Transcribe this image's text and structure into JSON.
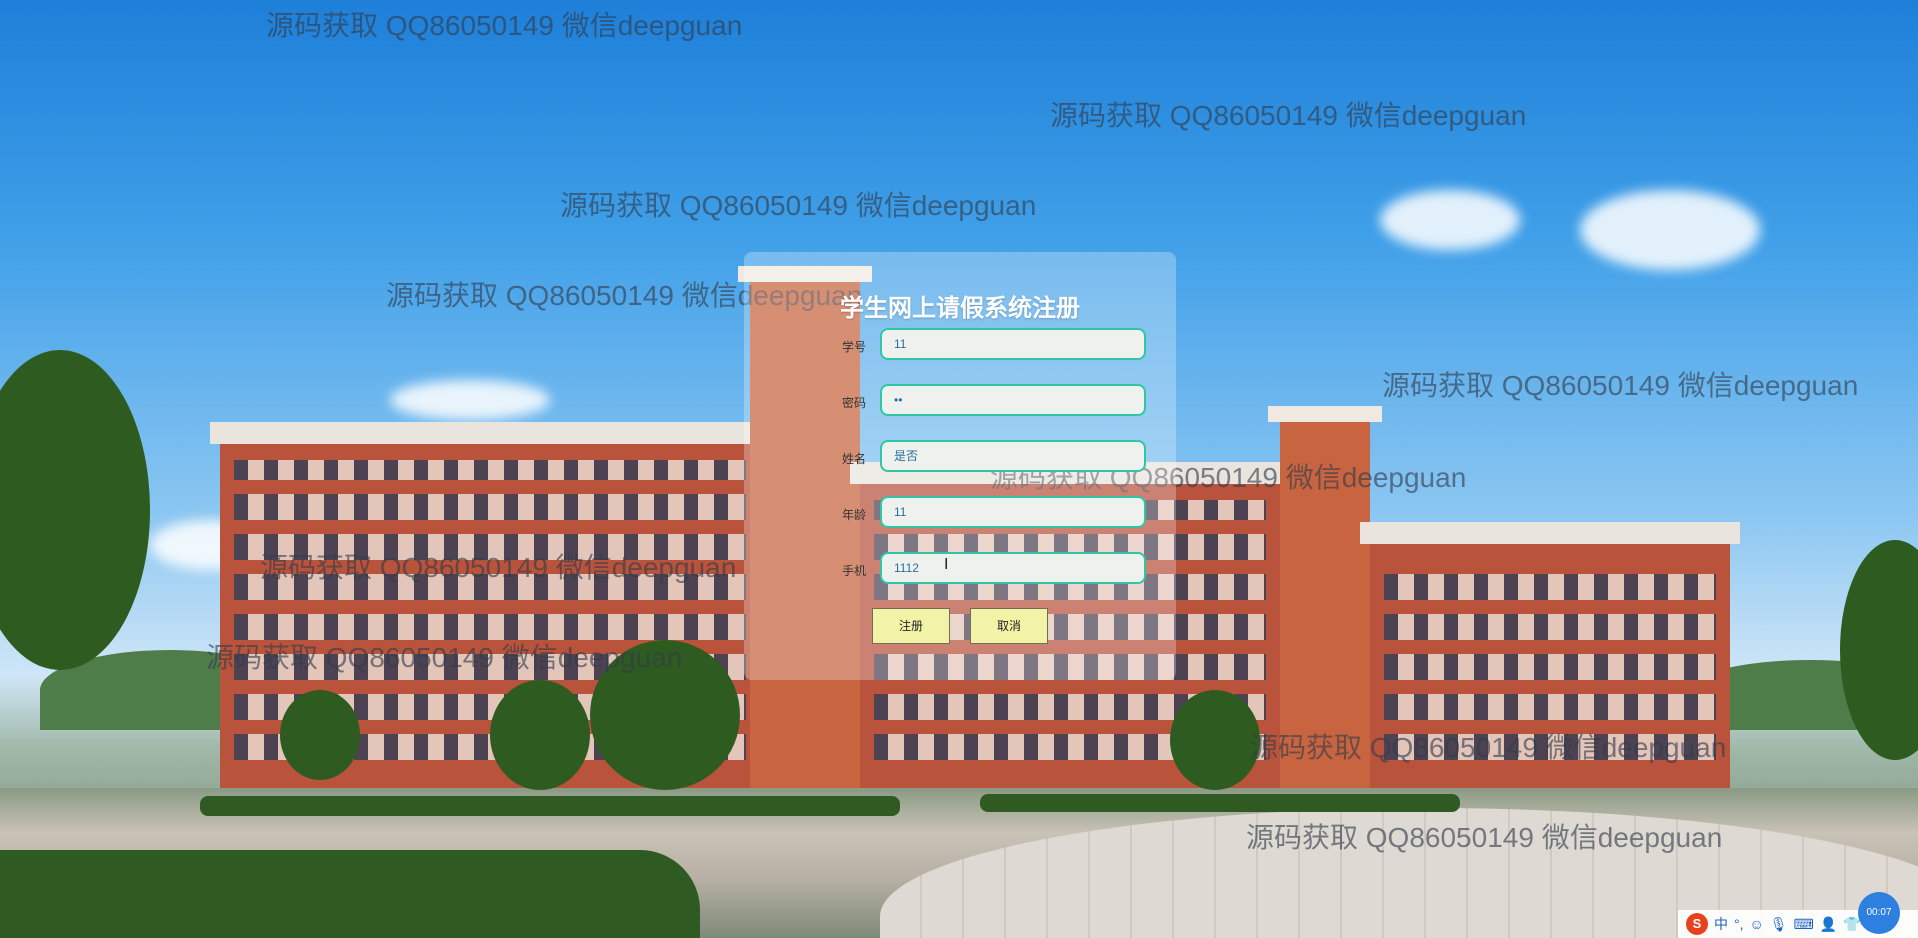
{
  "form": {
    "title": "学生网上请假系统注册",
    "fields": [
      {
        "label": "学号",
        "value": "11"
      },
      {
        "label": "密码",
        "value": "••"
      },
      {
        "label": "姓名",
        "value": "是否"
      },
      {
        "label": "年龄",
        "value": "11"
      },
      {
        "label": "手机",
        "value": "1112"
      }
    ],
    "register_label": "注册",
    "cancel_label": "取消"
  },
  "watermark": "源码获取 QQ86050149 微信deepguan",
  "tray": {
    "ime_label": "中",
    "timer_label": "00:07"
  }
}
